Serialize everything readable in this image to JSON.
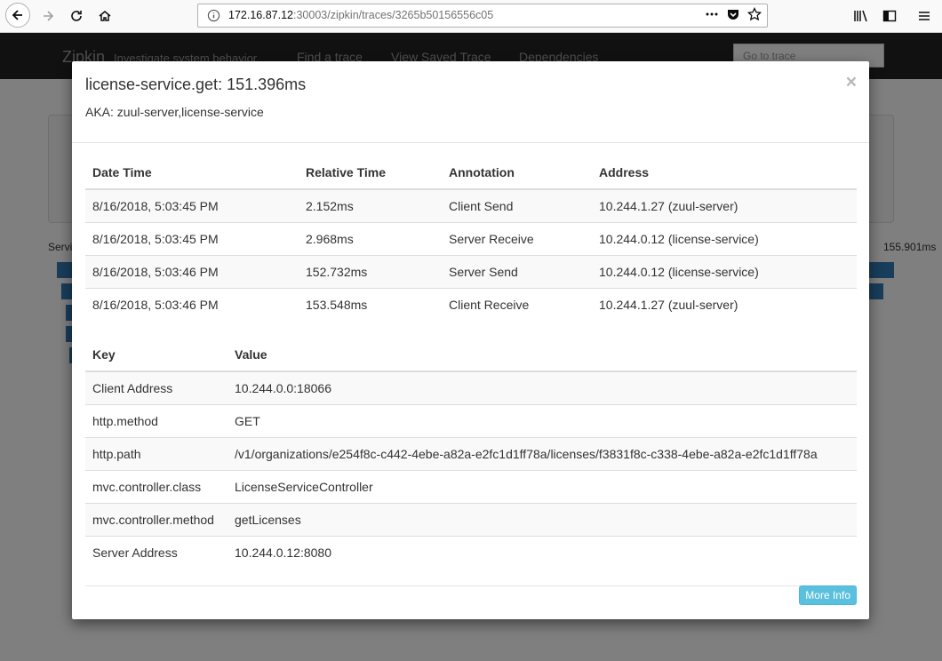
{
  "browser": {
    "url_host": "172.16.87.12",
    "url_path": ":30003/zipkin/traces/3265b50156556c05"
  },
  "app": {
    "brand": "Zipkin",
    "tagline": "Investigate system behavior",
    "nav": [
      "Find a trace",
      "View Saved Trace",
      "Dependencies"
    ],
    "goto_placeholder": "Go to trace",
    "services_label": "Servi",
    "duration": "155.901ms"
  },
  "modal": {
    "title": "license-service.get: 151.396ms",
    "aka": "AKA: zuul-server,license-service",
    "close": "×",
    "annotations": {
      "headers": [
        "Date Time",
        "Relative Time",
        "Annotation",
        "Address"
      ],
      "rows": [
        [
          "8/16/2018, 5:03:45 PM",
          "2.152ms",
          "Client Send",
          "10.244.1.27 (zuul-server)"
        ],
        [
          "8/16/2018, 5:03:45 PM",
          "2.968ms",
          "Server Receive",
          "10.244.0.12 (license-service)"
        ],
        [
          "8/16/2018, 5:03:46 PM",
          "152.732ms",
          "Server Send",
          "10.244.0.12 (license-service)"
        ],
        [
          "8/16/2018, 5:03:46 PM",
          "153.548ms",
          "Client Receive",
          "10.244.1.27 (zuul-server)"
        ]
      ]
    },
    "tags": {
      "headers": [
        "Key",
        "Value"
      ],
      "rows": [
        [
          "Client Address",
          "10.244.0.0:18066"
        ],
        [
          "http.method",
          "GET"
        ],
        [
          "http.path",
          "/v1/organizations/e254f8c-c442-4ebe-a82a-e2fc1d1ff78a/licenses/f3831f8c-c338-4ebe-a82a-e2fc1d1ff78a"
        ],
        [
          "mvc.controller.class",
          "LicenseServiceController"
        ],
        [
          "mvc.controller.method",
          "getLicenses"
        ],
        [
          "Server Address",
          "10.244.0.12:8080"
        ]
      ]
    },
    "more_info": "More Info"
  }
}
